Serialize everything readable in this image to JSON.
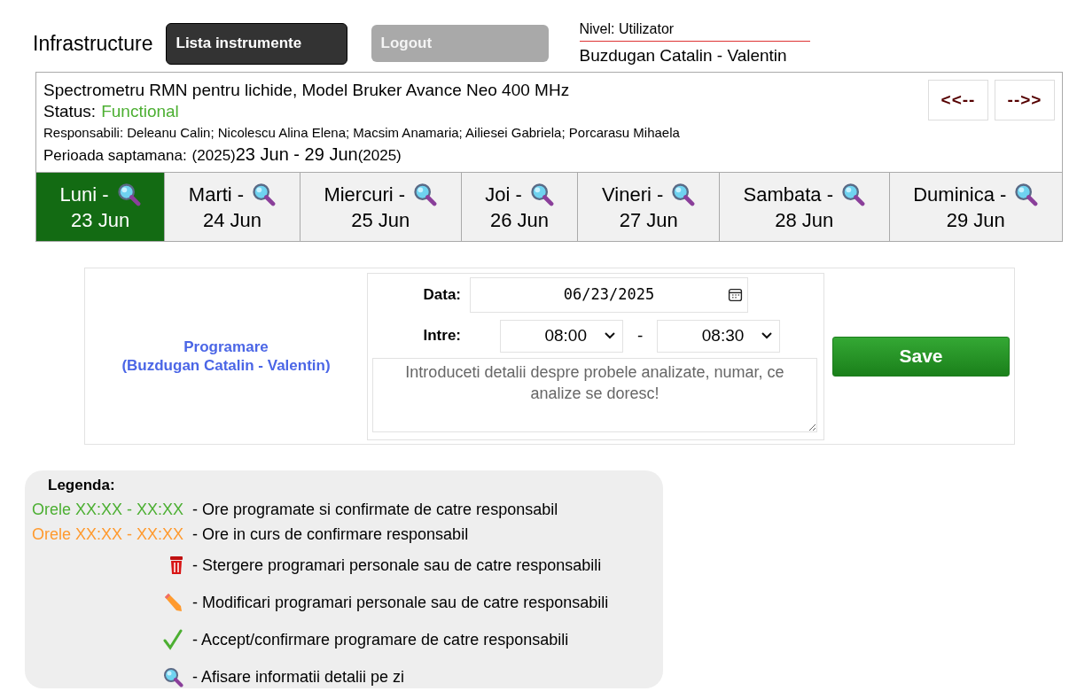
{
  "header": {
    "title": "Infrastructure",
    "buttons": [
      {
        "label": "Lista instrumente",
        "kind": "dark"
      },
      {
        "label": "Logout",
        "kind": "muted"
      }
    ],
    "level": "Nivel: Utilizator",
    "user": "Buzdugan Catalin - Valentin"
  },
  "instrument": {
    "name": "Spectrometru RMN pentru lichide, Model Bruker Avance Neo 400 MHz",
    "status_label": "Status:",
    "status": "Functional",
    "responsible": "Responsabili: Deleanu Calin; Nicolescu Alina Elena; Macsim Anamaria; Ailiesei Gabriela; Porcarasu Mihaela",
    "period_label": "Perioada saptamana:",
    "period_year_start": "(2025)",
    "period": "23 Jun - 29 Jun",
    "period_year_end": "(2025)",
    "nav": [
      "<<--",
      "-->>"
    ]
  },
  "days": [
    {
      "label": "Luni -",
      "date": "23 Jun",
      "selected": true
    },
    {
      "label": "Marti -",
      "date": "24 Jun",
      "selected": false
    },
    {
      "label": "Miercuri -",
      "date": "25 Jun",
      "selected": false
    },
    {
      "label": "Joi -",
      "date": "26 Jun",
      "selected": false
    },
    {
      "label": "Vineri -",
      "date": "27 Jun",
      "selected": false
    },
    {
      "label": "Sambata -",
      "date": "28 Jun",
      "selected": false
    },
    {
      "label": "Duminica -",
      "date": "29 Jun",
      "selected": false
    }
  ],
  "booking": {
    "title": "Programare",
    "owner": "(Buzdugan Catalin - Valentin)",
    "date_label": "Data:",
    "date": "06/23/2025",
    "between_label": "Intre:",
    "start": "08:00",
    "separator": "-",
    "end": "08:30",
    "placeholder": "Introduceti detalii despre probele analizate, numar, ce analize se doresc!",
    "save": "Save"
  },
  "legend": {
    "title": "Legenda:",
    "items": [
      {
        "kind": "hours",
        "color": "#4caf32",
        "hours": "Orele XX:XX - XX:XX",
        "text": "- Ore programate si confirmate de catre responsabil"
      },
      {
        "kind": "hours",
        "color": "#ff9a2e",
        "hours": "Orele XX:XX - XX:XX",
        "text": "- Ore in curs de confirmare responsabil"
      },
      {
        "kind": "trash",
        "text": "- Stergere programari personale sau de catre responsabili"
      },
      {
        "kind": "pencil",
        "text": "- Modificari programari personale sau de catre responsabili"
      },
      {
        "kind": "check",
        "text": "- Accept/confirmare programare de catre responsabili"
      },
      {
        "kind": "search",
        "text": "- Afisare informatii detalii pe zi"
      }
    ]
  }
}
